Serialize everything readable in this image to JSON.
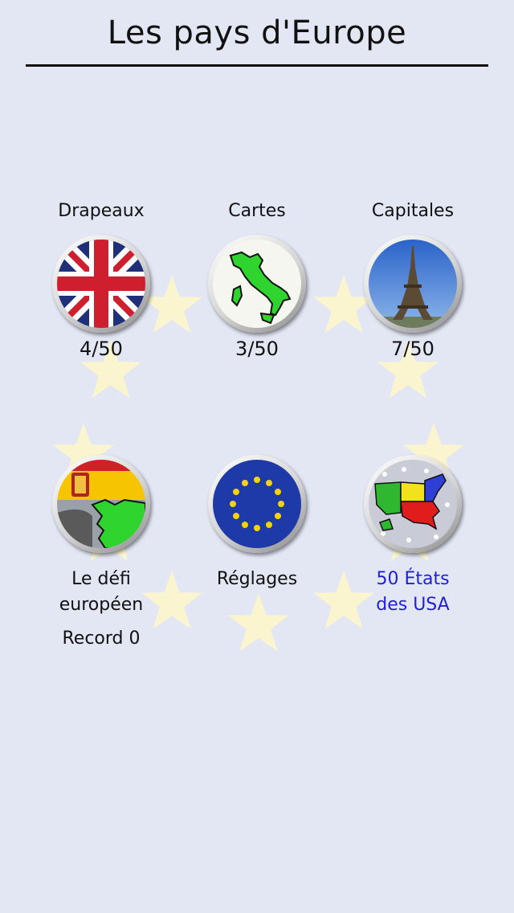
{
  "header": {
    "title": "Les pays d'Europe"
  },
  "menu": {
    "flags": {
      "label": "Drapeaux",
      "score": "4/50",
      "icon": "uk-flag-icon"
    },
    "maps": {
      "label": "Cartes",
      "score": "3/50",
      "icon": "italy-map-icon"
    },
    "capitals": {
      "label": "Capitales",
      "score": "7/50",
      "icon": "eiffel-tower-icon"
    },
    "challenge": {
      "label_line1": "Le défi",
      "label_line2": "européen",
      "record": "Record 0",
      "icon": "spain-flag-map-icon"
    },
    "settings": {
      "label": "Réglages",
      "icon": "eu-flag-icon"
    },
    "usa": {
      "label_line1": "50 États",
      "label_line2": "des USA",
      "icon": "usa-map-icon",
      "color": "#1f1fd6"
    }
  },
  "colors": {
    "background": "#e3e7f4",
    "star": "#fbf5cf",
    "link": "#1f1fd6"
  }
}
